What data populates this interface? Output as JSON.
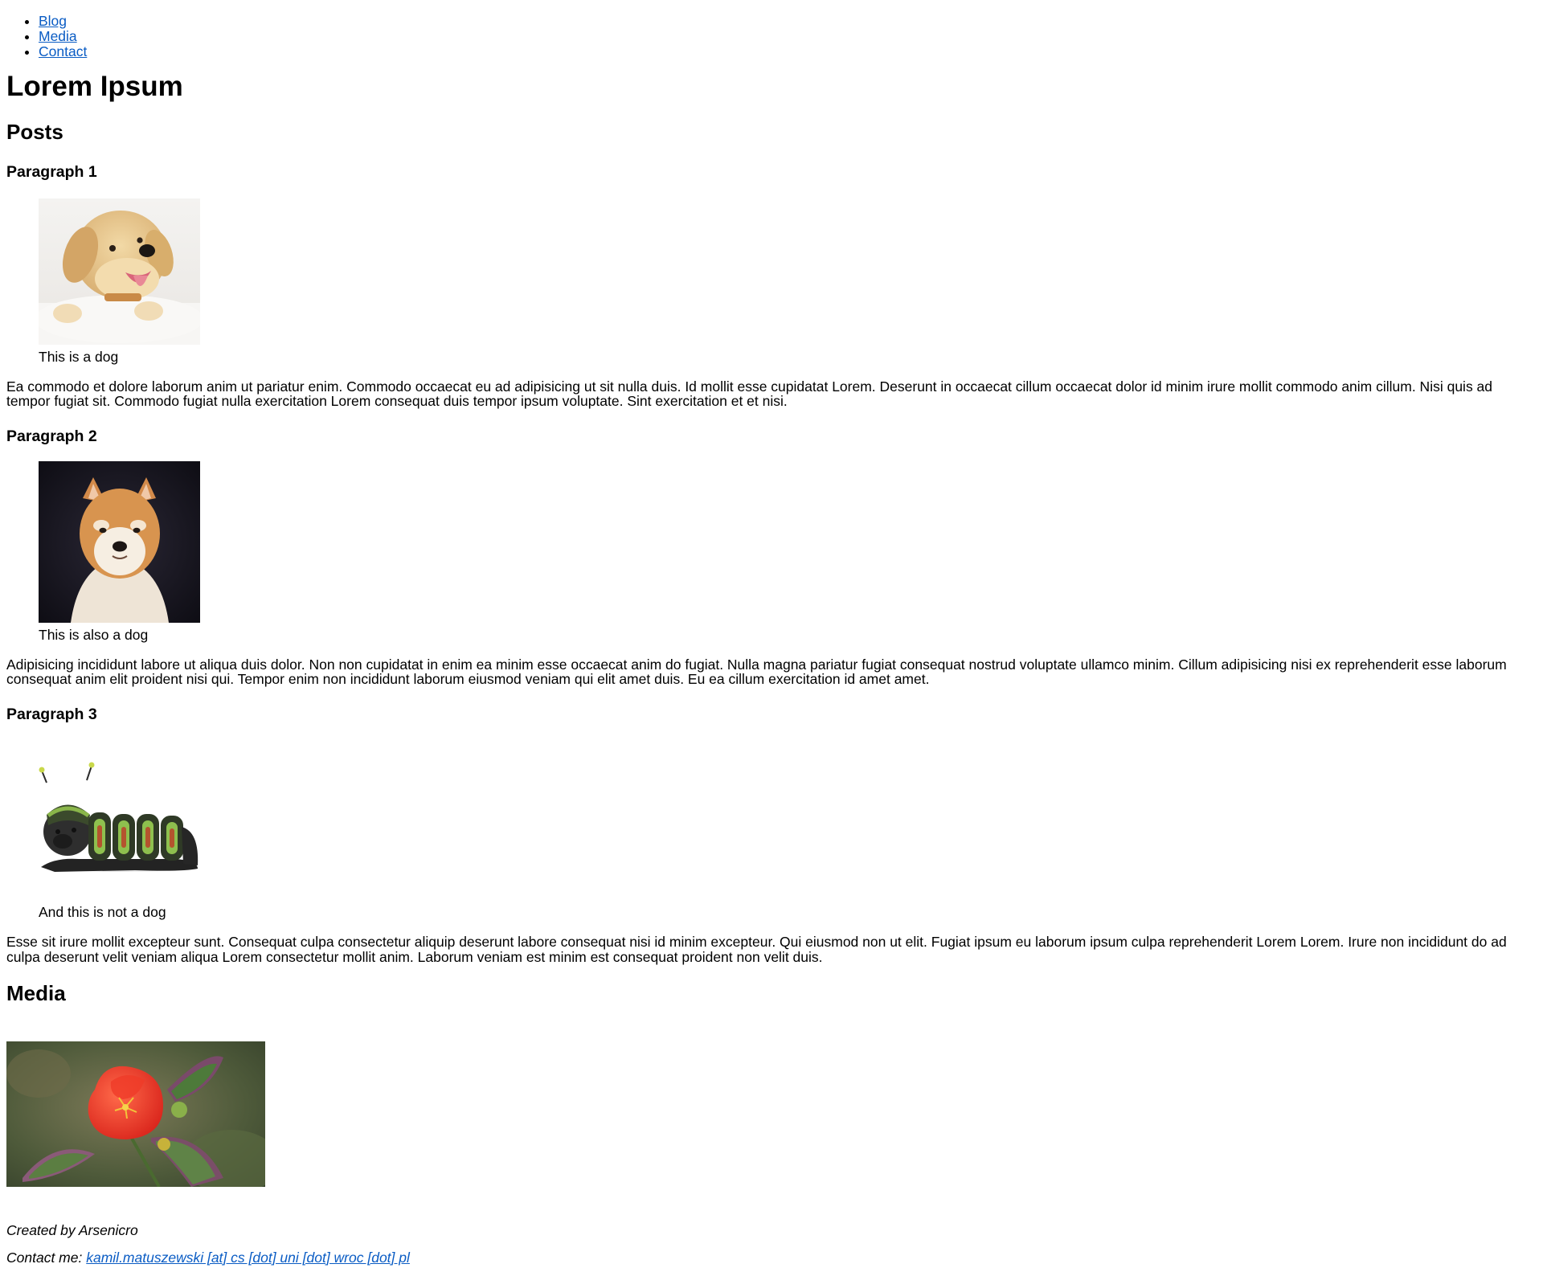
{
  "nav": {
    "items": [
      {
        "label": "Blog"
      },
      {
        "label": "Media"
      },
      {
        "label": "Contact"
      }
    ]
  },
  "page": {
    "title": "Lorem Ipsum"
  },
  "posts": {
    "heading": "Posts",
    "items": [
      {
        "heading": "Paragraph 1",
        "caption": "This is a dog",
        "text": "Ea commodo et dolore laborum anim ut pariatur enim. Commodo occaecat eu ad adipisicing ut sit nulla duis. Id mollit esse cupidatat Lorem. Deserunt in occaecat cillum occaecat dolor id minim irure mollit commodo anim cillum. Nisi quis ad tempor fugiat sit. Commodo fugiat nulla exercitation Lorem consequat duis tempor ipsum voluptate. Sint exercitation et et nisi."
      },
      {
        "heading": "Paragraph 2",
        "caption": "This is also a dog",
        "text": "Adipisicing incididunt labore ut aliqua duis dolor. Non non cupidatat in enim ea minim esse occaecat anim do fugiat. Nulla magna pariatur fugiat consequat nostrud voluptate ullamco minim. Cillum adipisicing nisi ex reprehenderit esse laborum consequat anim elit proident nisi qui. Tempor enim non incididunt laborum eiusmod veniam qui elit amet duis. Eu ea cillum exercitation id amet amet."
      },
      {
        "heading": "Paragraph 3",
        "caption": "And this is not a dog",
        "text": "Esse sit irure mollit excepteur sunt. Consequat culpa consectetur aliquip deserunt labore consequat nisi id minim excepteur. Qui eiusmod non ut elit. Fugiat ipsum eu laborum ipsum culpa reprehenderit Lorem Lorem. Irure non incididunt do ad culpa deserunt velit veniam aliqua Lorem consectetur mollit anim. Laborum veniam est minim est consequat proident non velit duis."
      }
    ]
  },
  "media": {
    "heading": "Media"
  },
  "footer": {
    "created": "Created by Arsenicro",
    "contact_prefix": "Contact me:",
    "contact_link": "kamil.matuszewski [at] cs [dot] uni [dot] wroc [dot] pl"
  }
}
